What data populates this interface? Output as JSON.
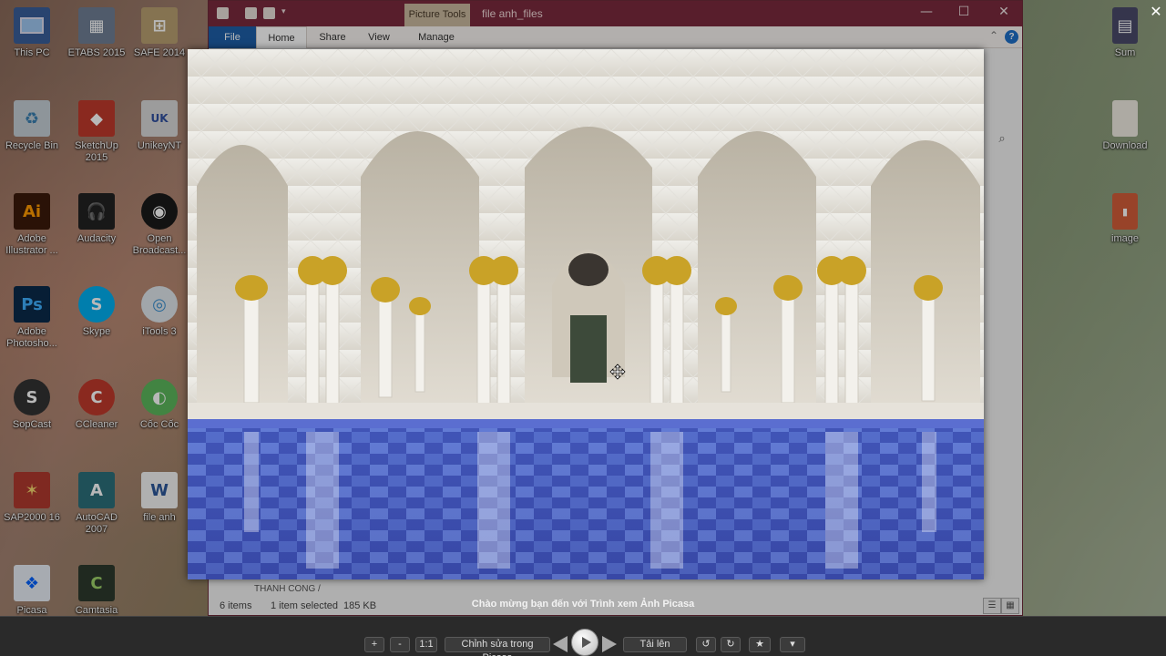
{
  "desktop": {
    "icons": [
      {
        "label": "This PC",
        "icon": "computer-icon"
      },
      {
        "label": "ETABS 2015",
        "icon": "etabs-icon"
      },
      {
        "label": "SAFE 2014",
        "icon": "safe-icon"
      },
      {
        "label": "Recycle Bin",
        "icon": "recycle-bin-icon"
      },
      {
        "label": "SketchUp 2015",
        "icon": "sketchup-icon"
      },
      {
        "label": "UnikeyNT",
        "icon": "unikey-icon"
      },
      {
        "label": "Adobe Illustrator ...",
        "icon": "illustrator-icon",
        "glyph": "Ai"
      },
      {
        "label": "Audacity",
        "icon": "audacity-icon"
      },
      {
        "label": "Open Broadcast...",
        "icon": "obs-icon"
      },
      {
        "label": "Adobe Photosho...",
        "icon": "photoshop-icon",
        "glyph": "Ps"
      },
      {
        "label": "Skype",
        "icon": "skype-icon",
        "glyph": "S"
      },
      {
        "label": "iTools 3",
        "icon": "itools-icon"
      },
      {
        "label": "SopCast",
        "icon": "sopcast-icon"
      },
      {
        "label": "CCleaner",
        "icon": "ccleaner-icon"
      },
      {
        "label": "Cốc Cốc",
        "icon": "coccoc-icon"
      },
      {
        "label": "SAP2000 16",
        "icon": "sap2000-icon"
      },
      {
        "label": "AutoCAD 2007",
        "icon": "autocad-icon",
        "glyph": "A"
      },
      {
        "label": "file anh",
        "icon": "word-document-icon",
        "glyph": "W"
      },
      {
        "label": "Picasa",
        "icon": "dropbox-icon"
      },
      {
        "label": "Camtasia",
        "icon": "camtasia-icon",
        "glyph": "C"
      }
    ],
    "right_icons": [
      {
        "label": "Sum",
        "icon": "archive-icon"
      },
      {
        "label": "Download",
        "icon": "folder-icon"
      },
      {
        "label": "image",
        "icon": "zip-folder-icon"
      }
    ]
  },
  "explorer": {
    "context_tab": "Picture Tools",
    "title": "file anh_files",
    "tabs": [
      "File",
      "Home",
      "Share",
      "View",
      "Manage"
    ],
    "status_items": "6 items",
    "status_selected": "1 item selected",
    "status_size": "185 KB",
    "partial_text": "THANH CONG /"
  },
  "viewer": {
    "caption": "Chào mừng bạn đến với Trình xem Ảnh Picasa",
    "toolbar": {
      "zoom_in": "+",
      "zoom_out": "-",
      "actual_size": "1:1",
      "edit_button": "Chỉnh sửa trong Picasa",
      "upload_button": "Tải lên"
    }
  },
  "colors": {
    "titlebar": "#7a2a3d",
    "file_tab": "#1e5fa8",
    "picture_tools": "#c9b99f",
    "viewer_bar": "#2a2a2a"
  }
}
